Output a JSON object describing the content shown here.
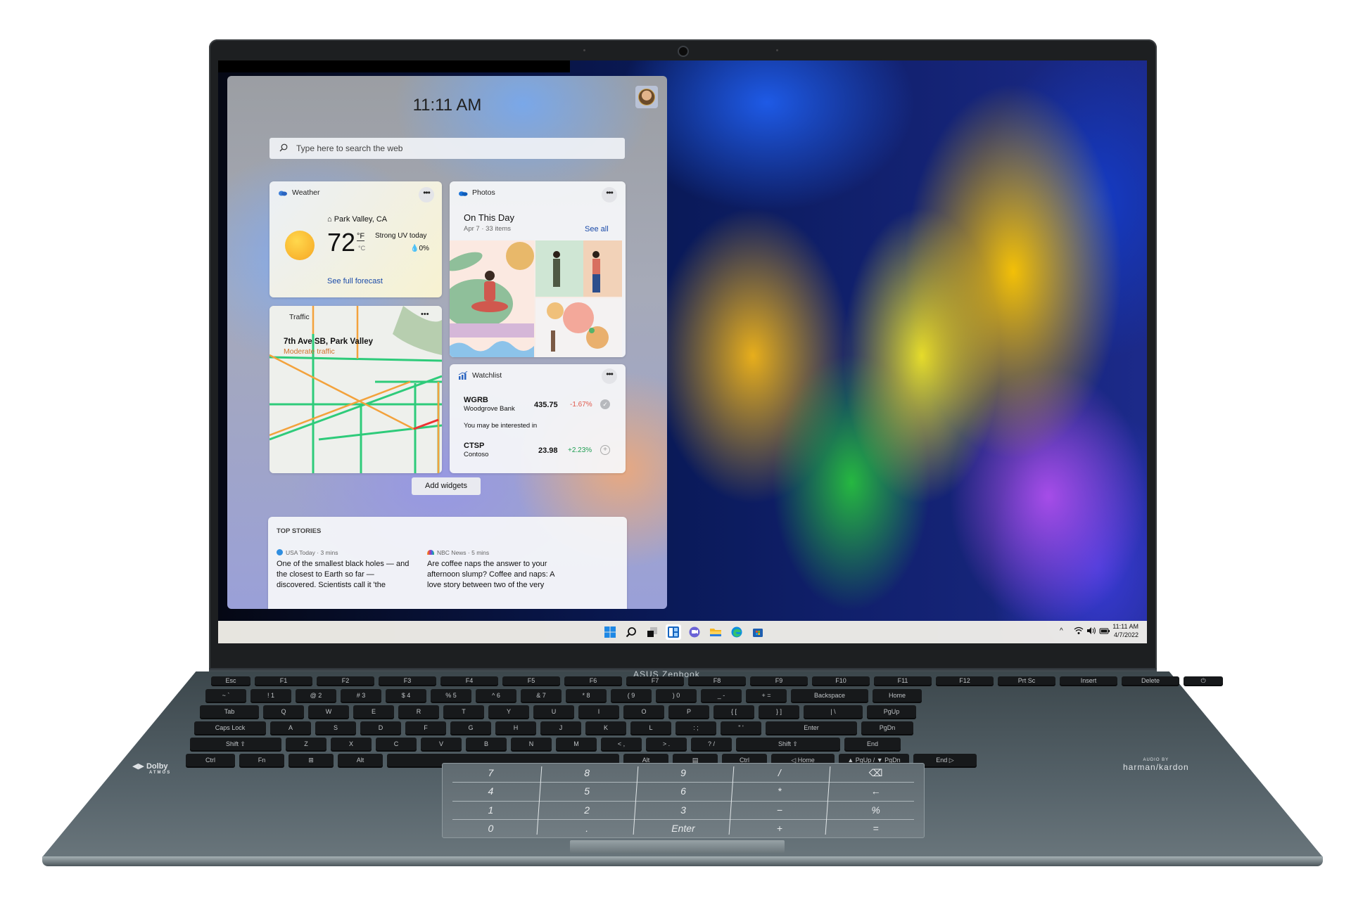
{
  "device": {
    "brand_label": "ASUS Zenbook",
    "audio_badge": "Dolby",
    "audio_badge_sub": "ATMOS",
    "speaker_badge_sub": "AUDIO BY",
    "speaker_badge": "harman/kardon"
  },
  "widgets_panel": {
    "clock": "11:11 AM",
    "search": {
      "placeholder": "Type here to search the web",
      "icon": "search-icon"
    },
    "avatar": "user-avatar",
    "weather": {
      "title": "Weather",
      "location": "Park Valley, CA",
      "temperature": "72",
      "unit_primary": "°F",
      "unit_secondary": "°C",
      "condition": "Strong UV today",
      "precipitation": "0%",
      "link": "See full forecast",
      "more": "•••"
    },
    "photos": {
      "title": "Photos",
      "heading": "On This Day",
      "subheading": "Apr 7  · 33 items",
      "link": "See all",
      "more": "•••"
    },
    "traffic": {
      "title": "Traffic",
      "location": "7th Ave SB, Park Valley",
      "status": "Moderate traffic",
      "more": "•••"
    },
    "watchlist": {
      "title": "Watchlist",
      "more": "•••",
      "stocks": [
        {
          "symbol": "WGRB",
          "name": "Woodgrove Bank",
          "price": "435.75",
          "change": "-1.67%",
          "change_color": "#e0584a",
          "action": "✓"
        }
      ],
      "suggestion_label": "You may be interested in",
      "suggestions": [
        {
          "symbol": "CTSP",
          "name": "Contoso",
          "price": "23.98",
          "change": "+2.23%",
          "change_color": "#1e9e52",
          "action": "+"
        }
      ]
    },
    "add_widgets": "Add widgets",
    "top_stories": {
      "title": "TOP STORIES",
      "items": [
        {
          "source": "USA Today · 3 mins",
          "headline_lines": [
            "One of the smallest black holes — and",
            "the closest to Earth so far —",
            "discovered. Scientists call it 'the"
          ]
        },
        {
          "source": "NBC News · 5 mins",
          "headline_lines": [
            "Are coffee naps the answer to your",
            "afternoon slump? Coffee and naps: A",
            "love story between two of the very"
          ]
        }
      ]
    }
  },
  "taskbar": {
    "icons": [
      "start-icon",
      "search-icon",
      "task-view-icon",
      "widgets-icon",
      "chat-icon",
      "file-explorer-icon",
      "edge-icon",
      "store-icon"
    ],
    "tray": {
      "chevron": "^",
      "time": "11:11 AM",
      "date": "4/7/2022"
    }
  },
  "keyboard": {
    "rows": [
      [
        "Esc",
        "F1",
        "F2",
        "F3",
        "F4",
        "F5",
        "F6",
        "F7",
        "F8",
        "F9",
        "F10",
        "F11",
        "F12",
        "Prt Sc",
        "Insert",
        "Delete",
        "⏻"
      ],
      [
        "~ `",
        "! 1",
        "@ 2",
        "# 3",
        "$ 4",
        "% 5",
        "^ 6",
        "& 7",
        "* 8",
        "( 9",
        ") 0",
        "_ -",
        "+ =",
        "Backspace",
        "Home"
      ],
      [
        "Tab",
        "Q",
        "W",
        "E",
        "R",
        "T",
        "Y",
        "U",
        "I",
        "O",
        "P",
        "{ [",
        "} ]",
        "| \\",
        "PgUp"
      ],
      [
        "Caps Lock",
        "A",
        "S",
        "D",
        "F",
        "G",
        "H",
        "J",
        "K",
        "L",
        ": ;",
        "\" '",
        "Enter",
        "PgDn"
      ],
      [
        "Shift ⇧",
        "Z",
        "X",
        "C",
        "V",
        "B",
        "N",
        "M",
        "< ,",
        "> .",
        "? /",
        "Shift ⇧",
        "End"
      ],
      [
        "Ctrl",
        "Fn",
        "⊞",
        "Alt",
        "",
        "Alt",
        "▤",
        "Ctrl",
        "◁ Home",
        "▲ PgUp / ▼ PgDn",
        "End ▷"
      ]
    ]
  },
  "numberpad": {
    "keys": [
      [
        "7",
        "8",
        "9",
        "/",
        "⌫"
      ],
      [
        "4",
        "5",
        "6",
        "*",
        "←"
      ],
      [
        "1",
        "2",
        "3",
        "−",
        "%"
      ],
      [
        "0",
        ".",
        "Enter",
        "+",
        "="
      ]
    ],
    "display": [
      "7",
      "8",
      "9",
      "/",
      "",
      " 4",
      "5",
      "6",
      "*",
      "←",
      "1",
      "2",
      "3",
      "—",
      "%",
      "0",
      "·",
      "Enter",
      "+",
      "="
    ]
  }
}
